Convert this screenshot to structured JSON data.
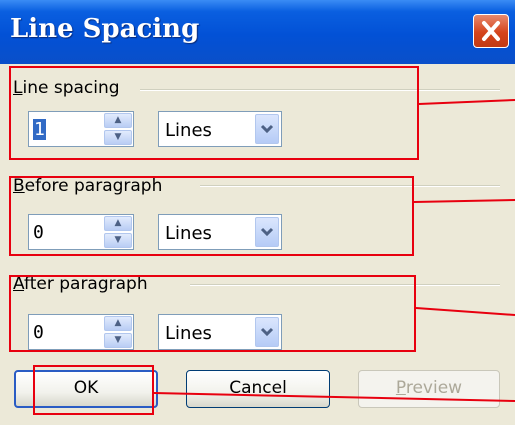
{
  "window": {
    "title": "Line Spacing"
  },
  "groups": {
    "line_spacing": {
      "label_ul": "L",
      "label_rest": "ine spacing",
      "value": "1",
      "unit": "Lines"
    },
    "before": {
      "label_ul": "B",
      "label_rest": "efore paragraph",
      "value": "0",
      "unit": "Lines"
    },
    "after": {
      "label_ul": "A",
      "label_rest": "fter paragraph",
      "value": "0",
      "unit": "Lines"
    }
  },
  "buttons": {
    "ok": "OK",
    "cancel": "Cancel",
    "preview_ul": "P",
    "preview_rest": "review"
  },
  "colors": {
    "highlight": "#e8000f",
    "titlebar": "#0251d6"
  }
}
